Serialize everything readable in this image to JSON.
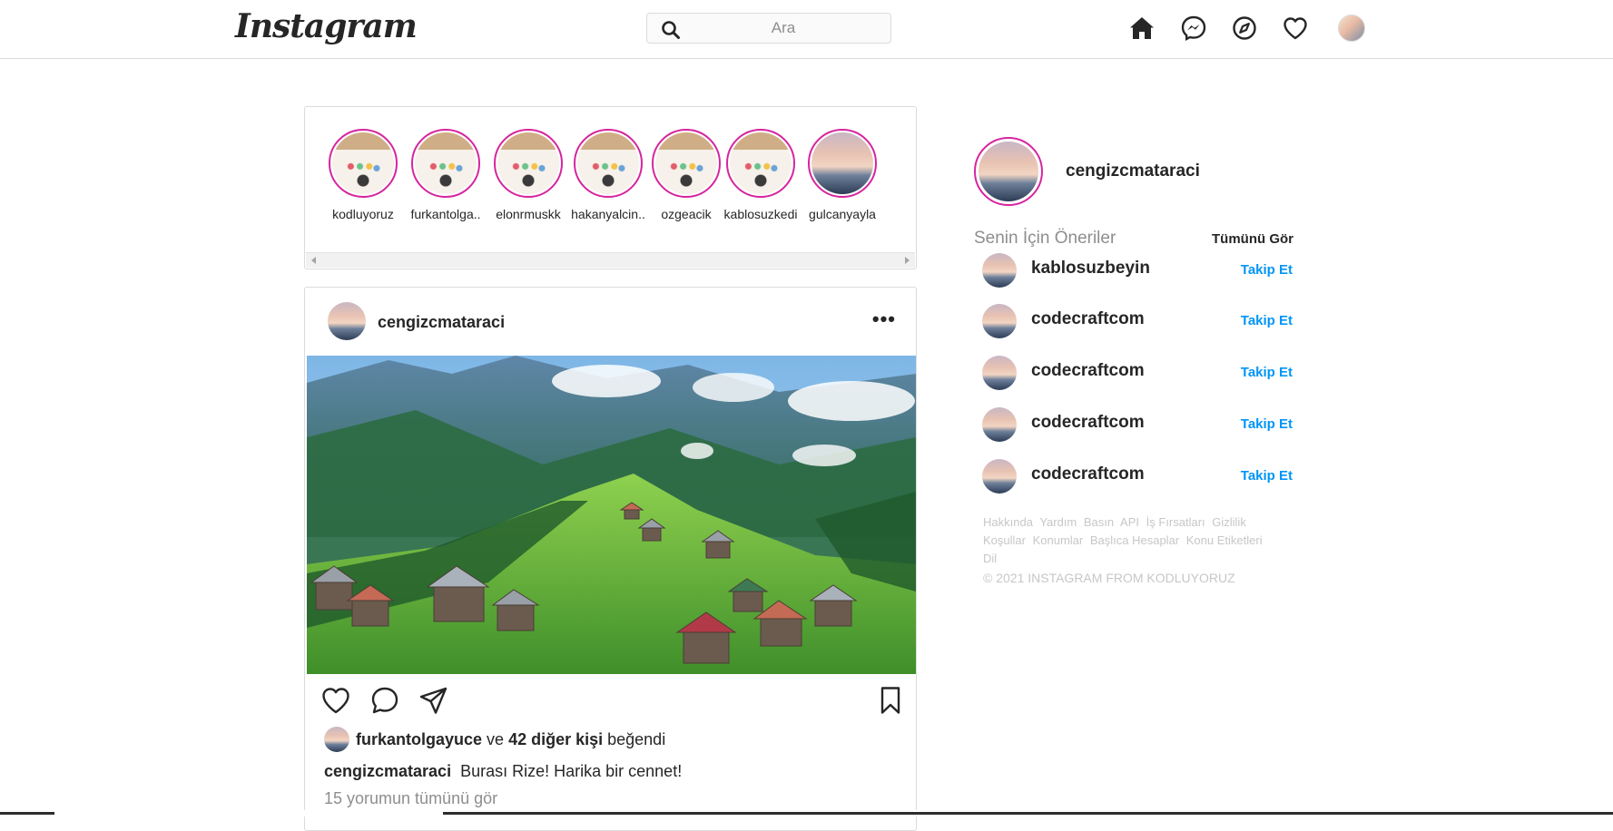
{
  "header": {
    "logo": "Instagram",
    "search_placeholder": "Ara",
    "icons": [
      "home-icon",
      "messenger-icon",
      "explore-icon",
      "heart-icon",
      "profile-avatar"
    ]
  },
  "stories": [
    {
      "name": "kodluyoruz",
      "image": "desk"
    },
    {
      "name": "furkantolga..",
      "image": "desk"
    },
    {
      "name": "elonrmuskk",
      "image": "desk"
    },
    {
      "name": "hakanyalcin..",
      "image": "desk"
    },
    {
      "name": "ozgeacik",
      "image": "desk"
    },
    {
      "name": "kablosuzkedi",
      "image": "desk"
    },
    {
      "name": "gulcanyayla",
      "image": "sunset"
    }
  ],
  "post": {
    "username": "cengizcmataraci",
    "more": "•••",
    "liked_by_user": "furkantolgayuce",
    "liked_and": "ve",
    "liked_others": "42 diğer kişi",
    "liked_suffix": "beğendi",
    "caption_user": "cengizcmataraci",
    "caption_text": "Burası Rize! Harika bir cennet!",
    "view_comments": "15 yorumun tümünü gör"
  },
  "sidebar": {
    "username": "cengizcmataraci",
    "suggestions_title": "Senin İçin Öneriler",
    "see_all": "Tümünü Gör",
    "suggestions": [
      {
        "name": "kablosuzbeyin",
        "action": "Takip Et"
      },
      {
        "name": "codecraftcom",
        "action": "Takip Et"
      },
      {
        "name": "codecraftcom",
        "action": "Takip Et"
      },
      {
        "name": "codecraftcom",
        "action": "Takip Et"
      },
      {
        "name": "codecraftcom",
        "action": "Takip Et"
      }
    ],
    "footer_links": [
      "Hakkında",
      "Yardım",
      "Basın",
      "API",
      "İş Fırsatları",
      "Gizlilik",
      "Koşullar",
      "Konumlar",
      "Başlıca Hesaplar",
      "Konu Etiketleri",
      "Dil"
    ],
    "copyright": "© 2021 INSTAGRAM FROM KODLUYORUZ"
  },
  "colors": {
    "accent_blue": "#0095f6",
    "story_ring": "#d6249f",
    "border": "#dbdbdb",
    "muted_text": "#8e8e8e"
  }
}
